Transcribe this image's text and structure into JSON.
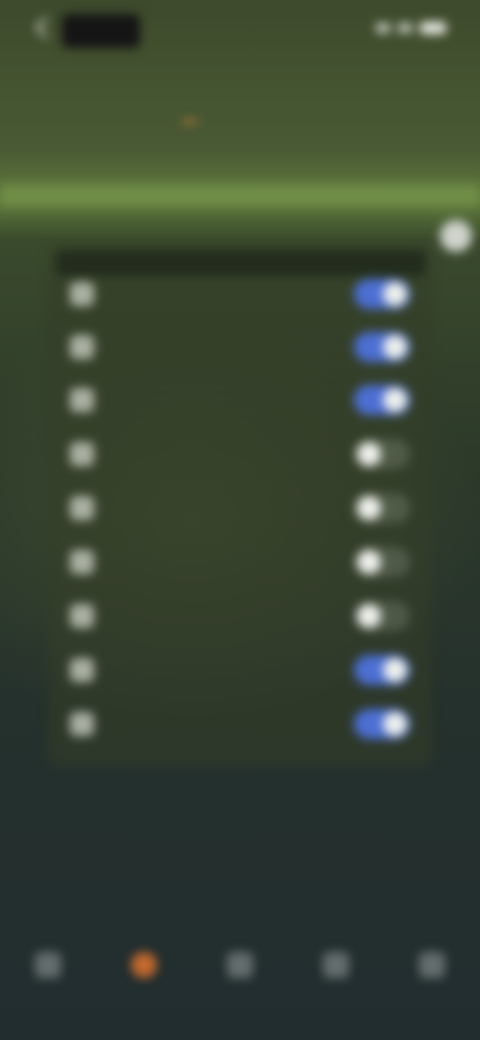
{
  "status_bar": {
    "icons": [
      "back-icon",
      "signal-icon",
      "wifi-icon",
      "battery-icon"
    ]
  },
  "header": {
    "tabs": [
      "",
      "",
      ""
    ],
    "sub": [
      "",
      ""
    ],
    "accent_color": "#d8823a"
  },
  "settings_list": [
    {
      "label": "",
      "icon": "toggle-icon",
      "on": true
    },
    {
      "label": "",
      "icon": "toggle-icon",
      "on": true
    },
    {
      "label": "",
      "icon": "toggle-icon",
      "on": true
    },
    {
      "label": "",
      "icon": "toggle-icon",
      "on": false
    },
    {
      "label": "",
      "icon": "toggle-icon",
      "on": false
    },
    {
      "label": "",
      "icon": "toggle-icon",
      "on": false
    },
    {
      "label": "",
      "icon": "toggle-icon",
      "on": false
    },
    {
      "label": "",
      "icon": "toggle-icon",
      "on": true
    },
    {
      "label": "",
      "icon": "toggle-icon",
      "on": true
    }
  ],
  "toggle_on_color": "#4c6fd3",
  "bottom_nav": [
    {
      "icon": "home-icon",
      "active": false
    },
    {
      "icon": "discover-icon",
      "active": true
    },
    {
      "icon": "add-icon",
      "active": false
    },
    {
      "icon": "message-icon",
      "active": false
    },
    {
      "icon": "profile-icon",
      "active": false
    }
  ]
}
